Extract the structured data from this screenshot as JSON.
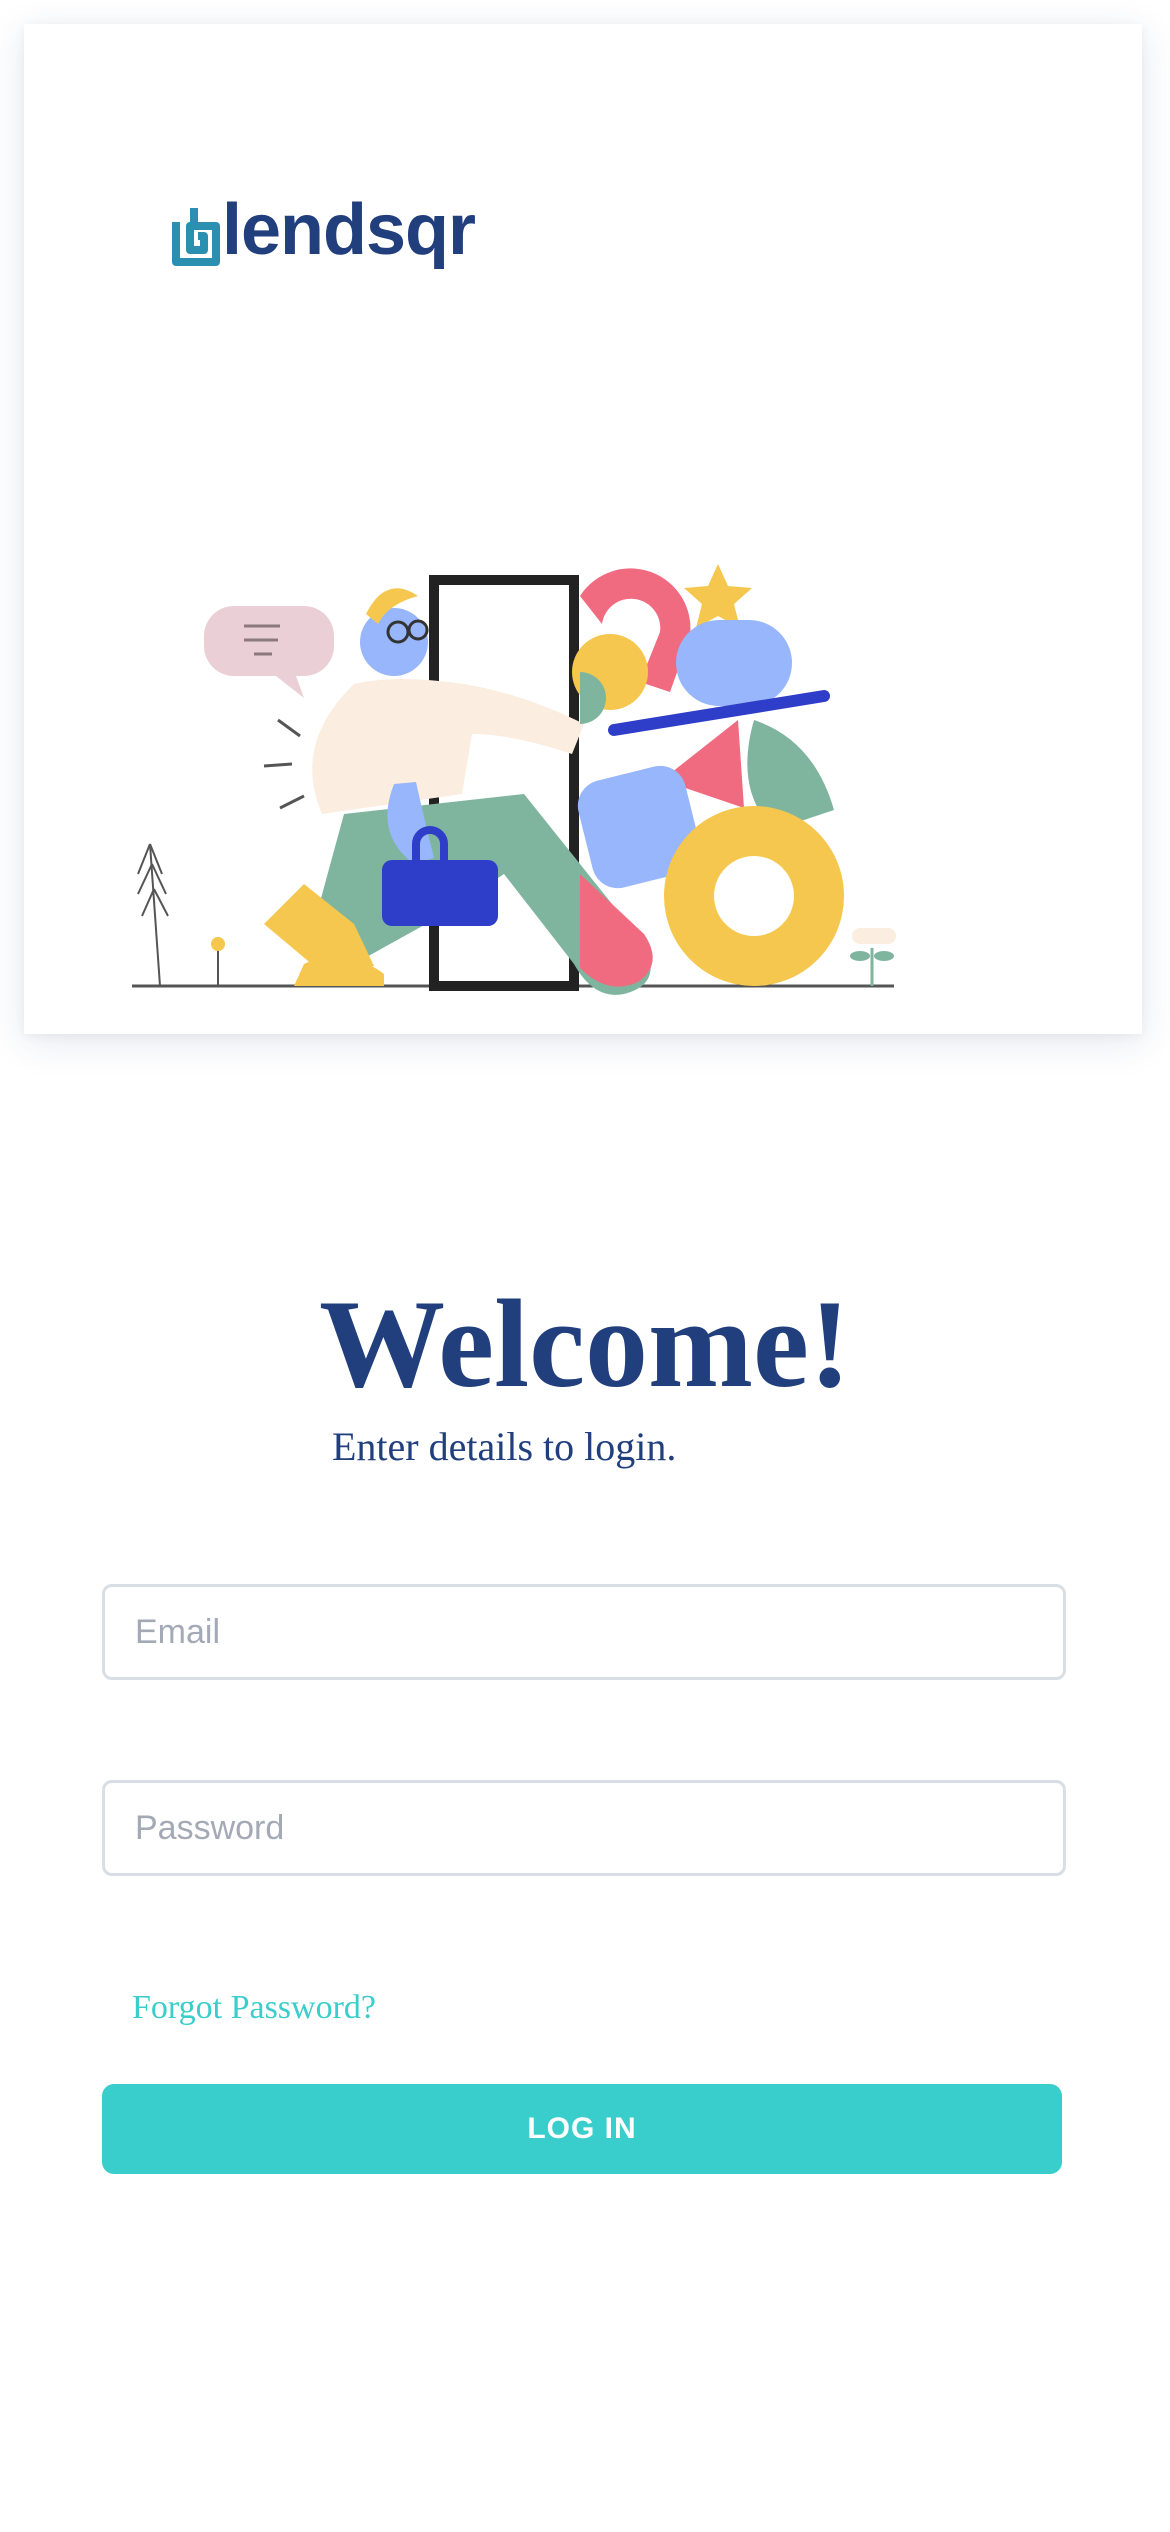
{
  "brand": {
    "name": "lendsqr",
    "primary_color": "#213F7D",
    "accent_color": "#39CDCC",
    "logo_icon": "lendsqr-logo-icon"
  },
  "hero": {
    "illustration": "person-walking-through-door-illustration"
  },
  "login": {
    "title": "Welcome!",
    "subtitle": "Enter details to login.",
    "email": {
      "placeholder": "Email",
      "value": ""
    },
    "password": {
      "placeholder": "Password",
      "value": ""
    },
    "forgot_label": "Forgot Password?",
    "submit_label": "LOG IN"
  }
}
